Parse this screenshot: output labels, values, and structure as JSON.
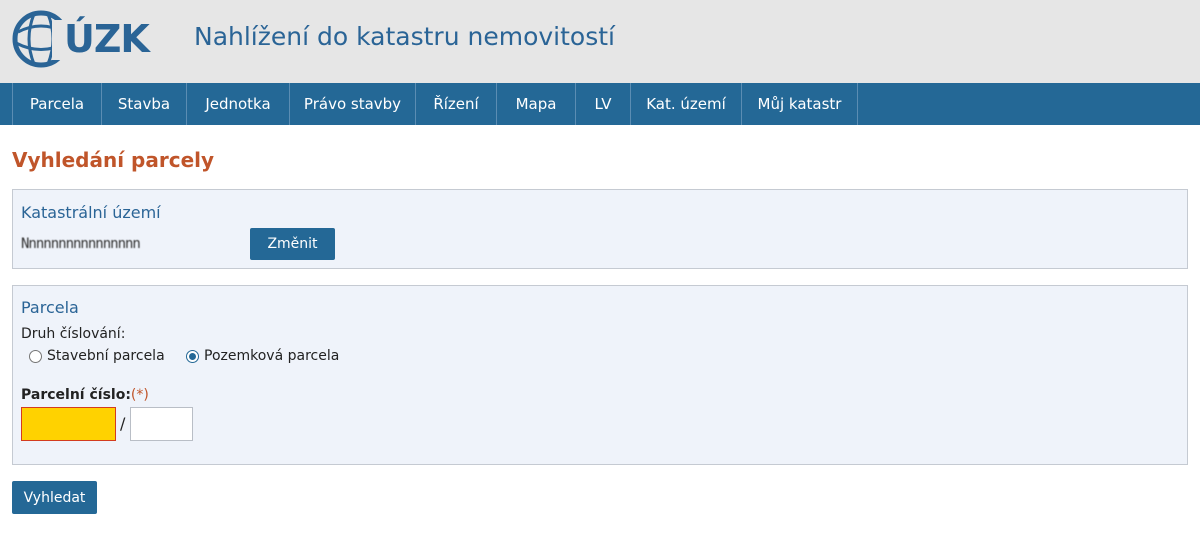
{
  "header": {
    "logo_text": "ÚZK",
    "site_title": "Nahlížení do katastru nemovitostí"
  },
  "nav": {
    "items": [
      {
        "label": "Parcela"
      },
      {
        "label": "Stavba"
      },
      {
        "label": "Jednotka"
      },
      {
        "label": "Právo stavby"
      },
      {
        "label": "Řízení"
      },
      {
        "label": "Mapa"
      },
      {
        "label": "LV"
      },
      {
        "label": "Kat. území"
      },
      {
        "label": "Můj katastr"
      }
    ]
  },
  "page_title": "Vyhledání parcely",
  "cadastral": {
    "title": "Katastrální území",
    "value": "Nnnnnnnnnnnnnnnn",
    "change_label": "Změnit"
  },
  "parcel": {
    "title": "Parcela",
    "numbering_label": "Druh číslování:",
    "option_building": "Stavební parcela",
    "option_land": "Pozemková parcela",
    "selected_option": "Pozemková parcela",
    "number_label": "Parcelní číslo:",
    "required_marker": "(*)",
    "slash": "/",
    "main_number": "",
    "sub_number": ""
  },
  "search_label": "Vyhledat",
  "colors": {
    "nav_bg": "#246896",
    "title_accent": "#c0552a",
    "required_field_bg": "#ffd200"
  }
}
